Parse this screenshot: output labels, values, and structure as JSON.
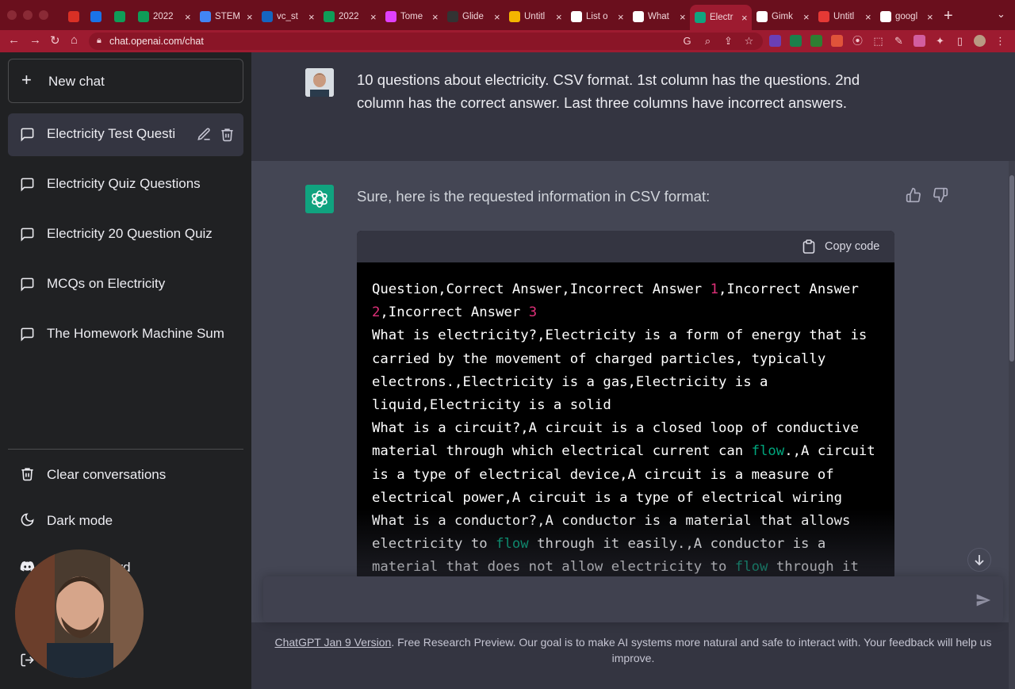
{
  "browser": {
    "tabs": [
      {
        "title": "",
        "icon": "gmail-icon",
        "color": "#d93025"
      },
      {
        "title": "",
        "icon": "calendar-icon",
        "color": "#1a73e8"
      },
      {
        "title": "",
        "icon": "drive-icon",
        "color": "#0f9d58"
      },
      {
        "title": "2022",
        "icon": "sheets-icon",
        "color": "#0f9d58"
      },
      {
        "title": "STEM",
        "icon": "docs-icon",
        "color": "#4285f4"
      },
      {
        "title": "vc_st",
        "icon": "doc-v-icon",
        "color": "#1565c0"
      },
      {
        "title": "2022",
        "icon": "sheets-icon",
        "color": "#0f9d58"
      },
      {
        "title": "Tome",
        "icon": "tome-icon",
        "color": "#e040fb"
      },
      {
        "title": "Glide",
        "icon": "glide-icon",
        "color": "#333333"
      },
      {
        "title": "Untitl",
        "icon": "slides-icon",
        "color": "#f4b400"
      },
      {
        "title": "List o",
        "icon": "wikipedia-icon",
        "color": "#ffffff"
      },
      {
        "title": "What",
        "icon": "site-icon",
        "color": "#ffffff"
      },
      {
        "title": "Electr",
        "icon": "chatgpt-icon",
        "color": "#10a37f",
        "active": true
      },
      {
        "title": "Gimk",
        "icon": "google-icon",
        "color": "#ffffff"
      },
      {
        "title": "Untitl",
        "icon": "app-icon",
        "color": "#e53935"
      },
      {
        "title": "googl",
        "icon": "google-icon",
        "color": "#ffffff"
      }
    ],
    "url": "chat.openai.com/chat"
  },
  "sidebar": {
    "new_chat_label": "New chat",
    "conversations": [
      "Electricity Test Questi",
      "Electricity Quiz Questions",
      "Electricity 20 Question Quiz",
      "MCQs on Electricity",
      "The Homework Machine Sum"
    ],
    "clear_label": "Clear conversations",
    "dark_mode_label": "Dark mode",
    "discord_label": "ord"
  },
  "chat": {
    "user_prompt": "10 questions about electricity. CSV format. 1st column has the questions. 2nd column has the correct answer. Last three columns have incorrect answers.",
    "assistant_intro": "Sure, here is the requested information in CSV format:",
    "copy_code_label": "Copy code",
    "code_lines": [
      [
        {
          "t": "Question,Correct Answer,Incorrect Answer "
        },
        {
          "t": "1",
          "c": "num"
        },
        {
          "t": ",Incorrect Answer"
        }
      ],
      [
        {
          "t": "2",
          "c": "num"
        },
        {
          "t": ",Incorrect Answer "
        },
        {
          "t": "3",
          "c": "num"
        }
      ],
      [
        {
          "t": "What is electricity?,Electricity is a form of energy that is"
        }
      ],
      [
        {
          "t": "carried by the movement of charged particles, typically"
        }
      ],
      [
        {
          "t": "electrons.,Electricity is a gas,Electricity is a"
        }
      ],
      [
        {
          "t": "liquid,Electricity is a solid"
        }
      ],
      [
        {
          "t": "What is a circuit?,A circuit is a closed loop of conductive"
        }
      ],
      [
        {
          "t": "material through which electrical current can "
        },
        {
          "t": "flow",
          "c": "kw"
        },
        {
          "t": ".,A circuit"
        }
      ],
      [
        {
          "t": "is a type of electrical device,A circuit is a measure of"
        }
      ],
      [
        {
          "t": "electrical power,A circuit is a type of electrical wiring"
        }
      ],
      [
        {
          "t": "What is a conductor?,A conductor is a material that allows"
        }
      ],
      [
        {
          "t": "electricity to "
        },
        {
          "t": "flow",
          "c": "kw"
        },
        {
          "t": " through it easily.,A conductor is a"
        }
      ],
      [
        {
          "t": "material that does not allow electricity to "
        },
        {
          "t": "flow",
          "c": "kw"
        },
        {
          "t": " through it"
        }
      ]
    ],
    "input_placeholder": ""
  },
  "footer": {
    "link": "ChatGPT Jan 9 Version",
    "text": ". Free Research Preview. Our goal is to make AI systems more natural and safe to interact with. Your feedback will help us improve."
  }
}
